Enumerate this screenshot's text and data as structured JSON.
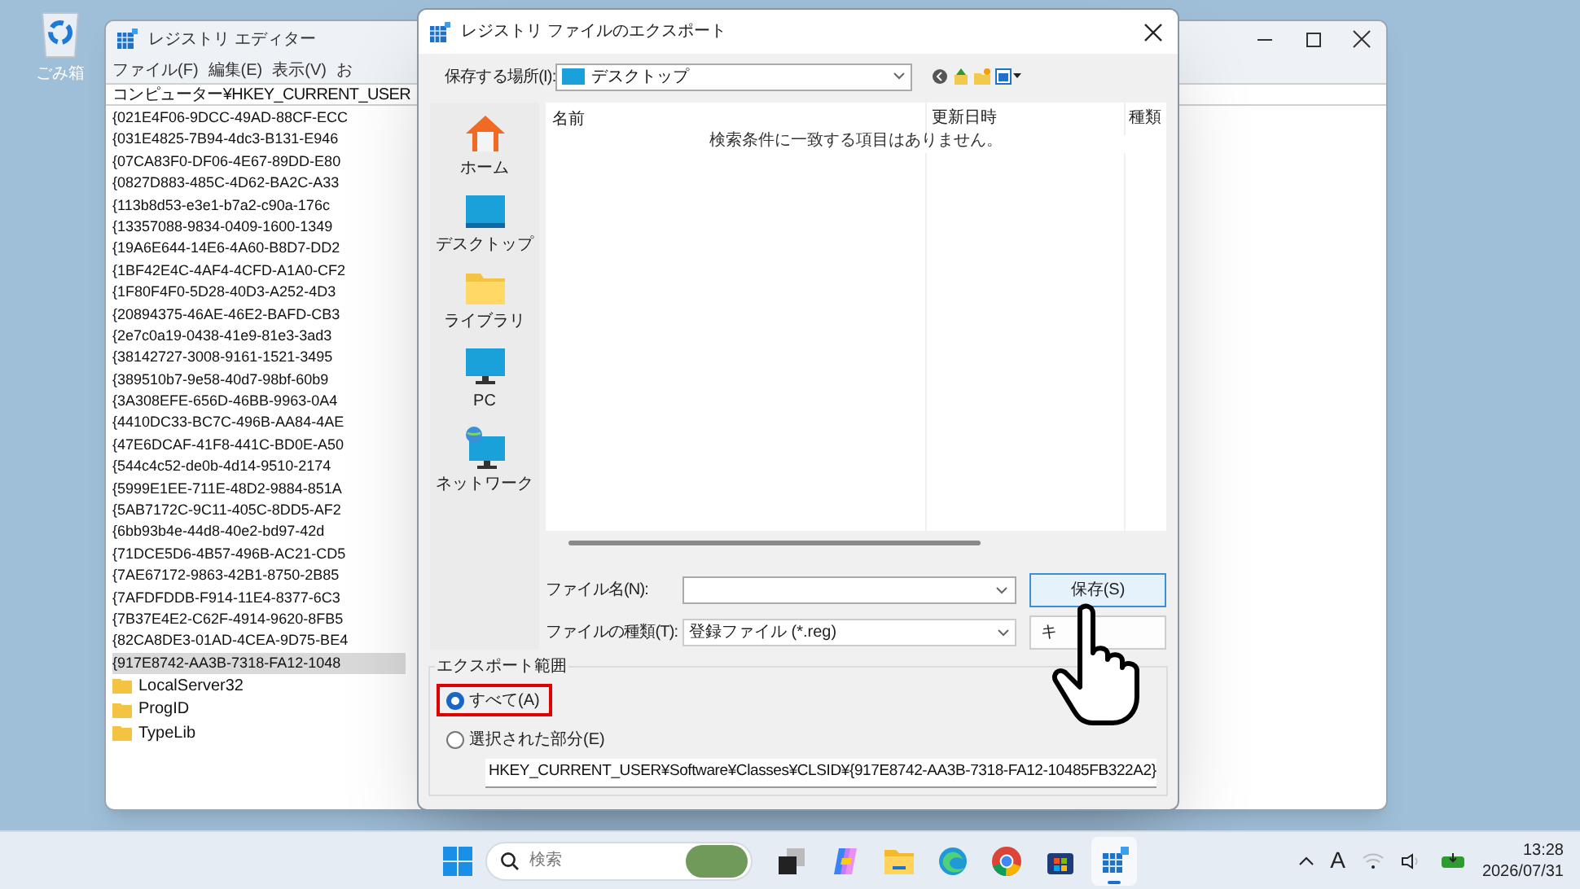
{
  "desktop": {
    "icons": [
      {
        "label": "ごみ箱"
      }
    ]
  },
  "registry_editor": {
    "title": "レジストリ エディター",
    "menu": [
      "ファイル(F)",
      "編集(E)",
      "表示(V)",
      "お"
    ],
    "address": "コンピューター¥HKEY_CURRENT_USER",
    "keys": [
      {
        "label": "{021E4F06-9DCC-49AD-88CF-ECC",
        "selected": false
      },
      {
        "label": "{031E4825-7B94-4dc3-B131-E946",
        "selected": false
      },
      {
        "label": "{07CA83F0-DF06-4E67-89DD-E80",
        "selected": false
      },
      {
        "label": "{0827D883-485C-4D62-BA2C-A33",
        "selected": false
      },
      {
        "label": "{113b8d53-e3e1-b7a2-c90a-176c",
        "selected": false
      },
      {
        "label": "{13357088-9834-0409-1600-1349",
        "selected": false
      },
      {
        "label": "{19A6E644-14E6-4A60-B8D7-DD2",
        "selected": false
      },
      {
        "label": "{1BF42E4C-4AF4-4CFD-A1A0-CF2",
        "selected": false
      },
      {
        "label": "{1F80F4F0-5D28-40D3-A252-4D3",
        "selected": false
      },
      {
        "label": "{20894375-46AE-46E2-BAFD-CB3",
        "selected": false
      },
      {
        "label": "{2e7c0a19-0438-41e9-81e3-3ad3",
        "selected": false
      },
      {
        "label": "{38142727-3008-9161-1521-3495",
        "selected": false
      },
      {
        "label": "{389510b7-9e58-40d7-98bf-60b9",
        "selected": false
      },
      {
        "label": "{3A308EFE-656D-46BB-9963-0A4",
        "selected": false
      },
      {
        "label": "{4410DC33-BC7C-496B-AA84-4AE",
        "selected": false
      },
      {
        "label": "{47E6DCAF-41F8-441C-BD0E-A50",
        "selected": false
      },
      {
        "label": "{544c4c52-de0b-4d14-9510-2174",
        "selected": false
      },
      {
        "label": "{5999E1EE-711E-48D2-9884-851A",
        "selected": false
      },
      {
        "label": "{5AB7172C-9C11-405C-8DD5-AF2",
        "selected": false
      },
      {
        "label": "{6bb93b4e-44d8-40e2-bd97-42d",
        "selected": false
      },
      {
        "label": "{71DCE5D6-4B57-496B-AC21-CD5",
        "selected": false
      },
      {
        "label": "{7AE67172-9863-42B1-8750-2B85",
        "selected": false
      },
      {
        "label": "{7AFDFDDB-F914-11E4-8377-6C3",
        "selected": false
      },
      {
        "label": "{7B37E4E2-C62F-4914-9620-8FB5",
        "selected": false
      },
      {
        "label": "{82CA8DE3-01AD-4CEA-9D75-BE4",
        "selected": false
      },
      {
        "label": "{917E8742-AA3B-7318-FA12-1048",
        "selected": true
      }
    ],
    "folders": [
      "LocalServer32",
      "ProgID",
      "TypeLib"
    ]
  },
  "dialog": {
    "title": "レジストリ ファイルのエクスポート",
    "location_label": "保存する場所(I):",
    "location_value": "デスクトップ",
    "places": [
      {
        "kind": "home",
        "label": "ホーム"
      },
      {
        "kind": "desktop",
        "label": "デスクトップ"
      },
      {
        "kind": "library",
        "label": "ライブラリ"
      },
      {
        "kind": "pc",
        "label": "PC"
      },
      {
        "kind": "network",
        "label": "ネットワーク"
      }
    ],
    "columns": [
      "名前",
      "更新日時",
      "種類"
    ],
    "empty_message": "検索条件に一致する項目はありません。",
    "filename_label": "ファイル名(N):",
    "filetype_label": "ファイルの種類(T):",
    "filetype_value": "登録ファイル (*.reg)",
    "save_button": "保存(S)",
    "cancel_button": "キ",
    "export_range": {
      "title": "エクスポート範囲",
      "options": [
        {
          "label": "すべて(A)",
          "selected": true,
          "highlighted": true
        },
        {
          "label": "選択された部分(E)",
          "selected": false,
          "highlighted": false
        }
      ],
      "branch": "HKEY_CURRENT_USER¥Software¥Classes¥CLSID¥{917E8742-AA3B-7318-FA12-10485FB322A2}"
    }
  },
  "taskbar": {
    "search_placeholder": "検索",
    "apps": [
      {
        "kind": "taskview",
        "active": false
      },
      {
        "kind": "copilot",
        "active": false
      },
      {
        "kind": "explorer",
        "active": false
      },
      {
        "kind": "edge",
        "active": false
      },
      {
        "kind": "chrome",
        "active": false
      },
      {
        "kind": "store",
        "active": false
      },
      {
        "kind": "regedit",
        "active": true
      }
    ],
    "ime": "A",
    "time": "13:28",
    "date": "2026/07/31"
  }
}
